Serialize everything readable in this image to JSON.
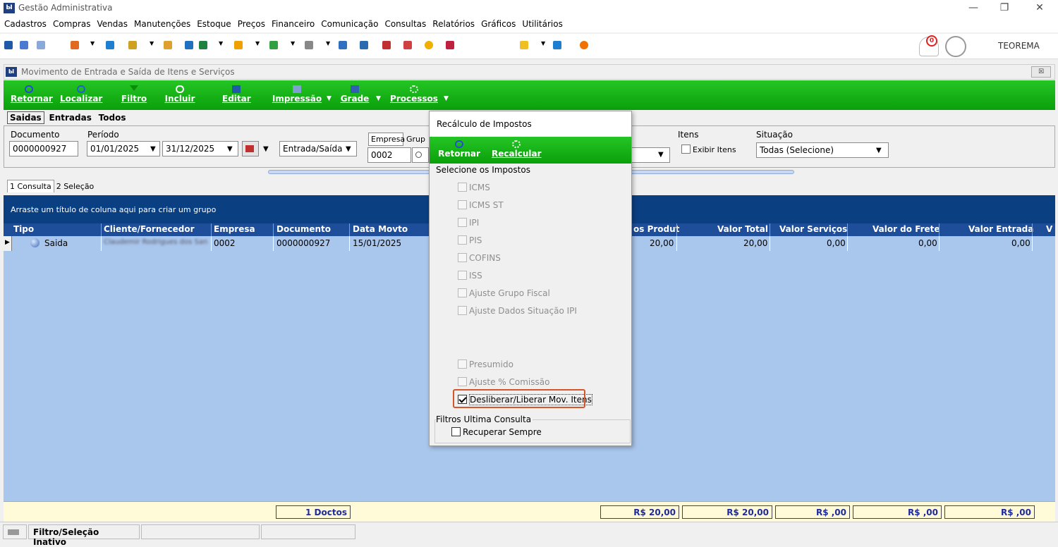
{
  "app": {
    "title": "Gestão Administrativa",
    "logo": "Ы",
    "user": "TEOREMA",
    "notification_count": "0"
  },
  "menu": [
    "Cadastros",
    "Compras",
    "Vendas",
    "Manutenções",
    "Estoque",
    "Preços",
    "Financeiro",
    "Comunicação",
    "Consultas",
    "Relatórios",
    "Gráficos",
    "Utilitários"
  ],
  "window": {
    "title": "Movimento de Entrada e Saída de Itens e Serviços",
    "close_label": "☒"
  },
  "toolbar": {
    "retornar": "Retornar",
    "localizar": "Localizar",
    "filtro": "Filtro",
    "incluir": "Incluir",
    "editar": "Editar",
    "impressao": "Impressão",
    "grade": "Grade",
    "processos": "Processos"
  },
  "tabs": {
    "saidas": "Saidas",
    "entradas": "Entradas",
    "todos": "Todos"
  },
  "filters": {
    "documento_label": "Documento",
    "documento_value": "0000000927",
    "periodo_label": "Período",
    "periodo_inicio": "01/01/2025",
    "periodo_fim": "31/12/2025",
    "tipo_value": "Entrada/Saída",
    "empresa_label": "Empresa",
    "grupo_label": "Grup",
    "empresa_value": "0002",
    "itens_label": "Itens",
    "exibir_itens": "Exibir Itens",
    "situacao_label": "Situação",
    "situacao_value": "Todas (Selecione)"
  },
  "subtabs": {
    "consulta": "1 Consulta",
    "selecao": "2 Seleção"
  },
  "grid": {
    "group_hint": "Arraste um título de coluna aqui para criar um grupo",
    "columns": [
      "Tipo",
      "Cliente/Fornecedor",
      "Empresa",
      "Documento",
      "Data Movto",
      "os Produt",
      "Valor Total",
      "Valor Serviços",
      "Valor do Frete",
      "Valor Entrada",
      "V"
    ],
    "row": {
      "tipo": "Saida",
      "cliente": "Claudemir Rodrigues dos San",
      "empresa": "0002",
      "documento": "0000000927",
      "data": "15/01/2025",
      "produtos": "20,00",
      "total": "20,00",
      "servicos": "0,00",
      "frete": "0,00",
      "entrada": "0,00"
    }
  },
  "totals": {
    "doctos": "1 Doctos",
    "produtos": "R$ 20,00",
    "total": "R$ 20,00",
    "servicos": "R$ ,00",
    "frete": "R$ ,00",
    "entrada": "R$ ,00"
  },
  "status": {
    "filtro": "Filtro/Seleção Inativo"
  },
  "dialog": {
    "title": "Recálculo de Impostos",
    "retornar": "Retornar",
    "recalcular": "Recalcular",
    "section": "Selecione os Impostos",
    "options": [
      "ICMS",
      "ICMS ST",
      "IPI",
      "PIS",
      "COFINS",
      "ISS",
      "Ajuste Grupo Fiscal",
      "Ajuste Dados Situação IPI"
    ],
    "presumido": "Presumido",
    "ajuste_comissao": "Ajuste % Comissão",
    "desliberar": "Desliberar/Liberar Mov. Itens",
    "filtros_label": "Filtros Ultima Consulta",
    "recuperar": "Recuperar Sempre"
  },
  "colors": {
    "green": "#0aa00a",
    "grid_blue": "#a9c6ec",
    "header_blue": "#1e4e9a",
    "highlight": "#d6552a"
  }
}
